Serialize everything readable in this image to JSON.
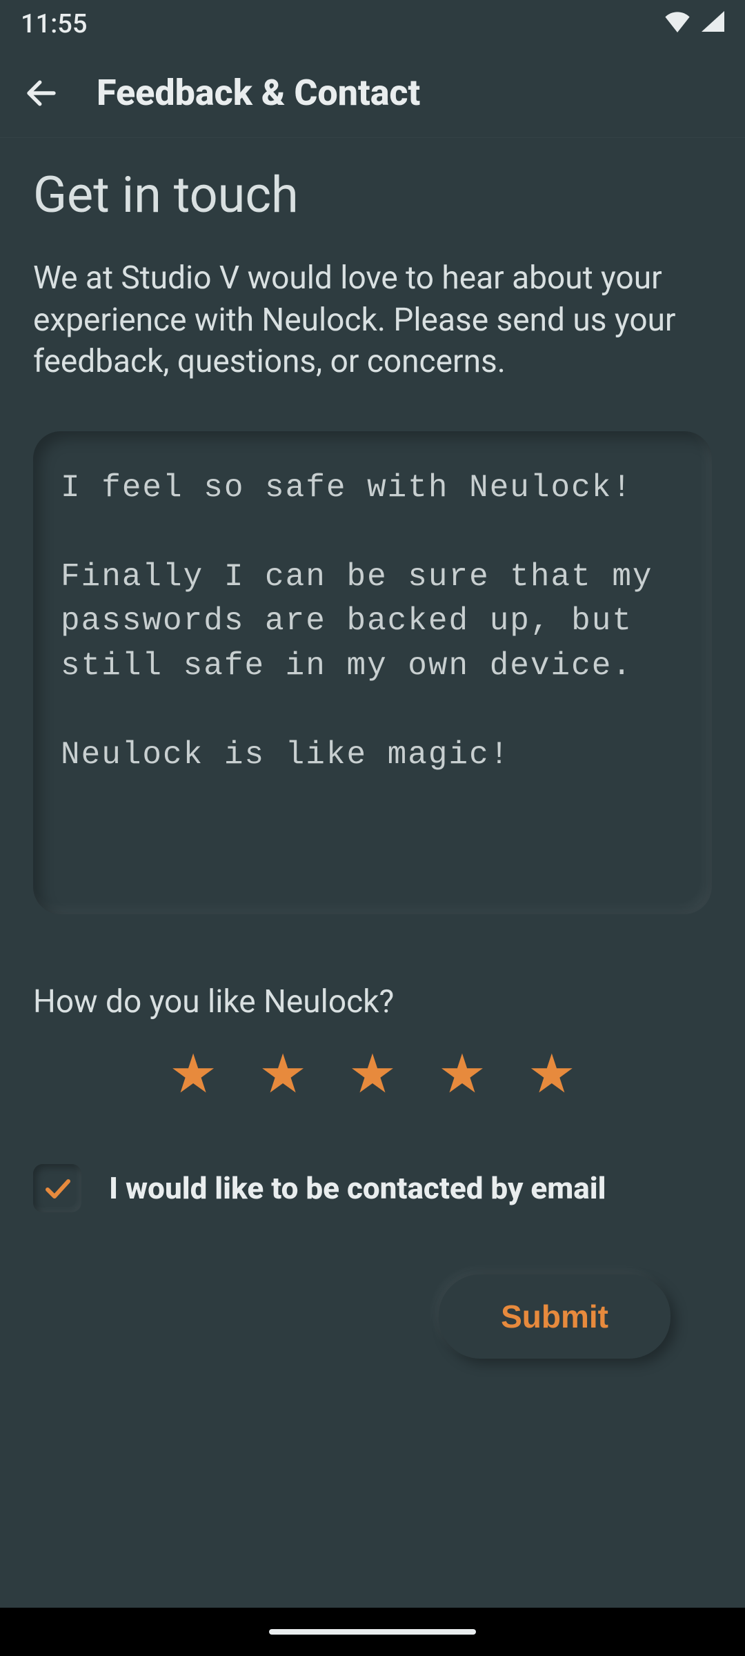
{
  "status": {
    "time": "11:55"
  },
  "appbar": {
    "title": "Feedback & Contact"
  },
  "page": {
    "heading": "Get in touch",
    "intro": "We at Studio V would love to hear about your experience with Neulock. Please send us your feedback, questions, or concerns.",
    "feedback_value": "I feel so safe with Neulock!\n\nFinally I can be sure that my passwords are backed up, but still safe in my own device.\n\nNeulock is like magic!",
    "rating_label": "How do you like Neulock?",
    "rating_value": 5,
    "contact_checkbox_label": "I would like to be contacted by email",
    "contact_checked": true,
    "submit_label": "Submit"
  },
  "colors": {
    "accent": "#e78a3d",
    "bg": "#2e3c40"
  }
}
